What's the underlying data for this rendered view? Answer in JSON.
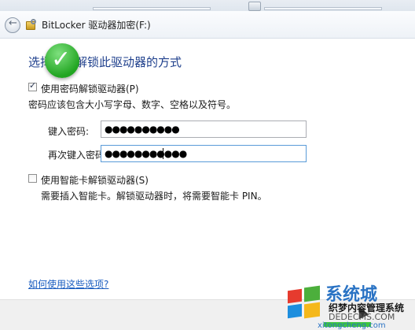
{
  "window": {
    "title": "BitLocker 驱动器加密(F:)",
    "back_glyph": "←"
  },
  "content": {
    "heading": "选择希望解锁此驱动器的方式",
    "password_option": {
      "label": "使用密码解锁驱动器(P)",
      "checked": true,
      "note": "密码应该包含大小写字母、数字、空格以及符号。"
    },
    "fields": {
      "enter_label": "键入密码:",
      "enter_value": "●●●●●●●●●●",
      "reenter_label": "再次键入密码:",
      "reenter_value": "●●●●●●●●●●●"
    },
    "smartcard_option": {
      "label": "使用智能卡解锁驱动器(S)",
      "checked": false,
      "note": "需要插入智能卡。解锁驱动器时，将需要智能卡 PIN。"
    },
    "help_link": "如何使用这些选项?"
  },
  "overlay": {
    "badge_glyph": "✓",
    "badge_color": "#22a522"
  },
  "watermark": {
    "brand": "系统城",
    "site": "织梦内容管理系统",
    "url": "DEDECMS.COM",
    "sub": "xitongcheng.com",
    "colors": [
      "#e63b2e",
      "#4caf3c",
      "#1d8ede",
      "#f5b81b"
    ]
  },
  "icons": {
    "back": "back-arrow-icon",
    "app": "bitlocker-key-icon",
    "drive": "drive-icon"
  }
}
